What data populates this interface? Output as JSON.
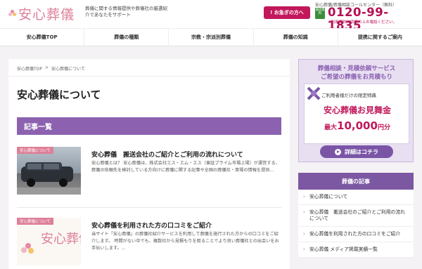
{
  "header": {
    "logo_text": "安心葬儀",
    "tagline": "葬儀に関する情報提供や葬儀社の厳選紹介であなたをサポート",
    "urgent_button": "! お急ぎの方へ",
    "call_center": "安心葬儀/葬儀相談コールセンター（無料）",
    "free_badge": "通話無料",
    "phone": "0120-99-1835",
    "call_note": "※利用規約に同意の上お電話ください。"
  },
  "nav": {
    "items": [
      "安心葬儀TOP",
      "葬儀の種類",
      "宗教・宗派別葬儀",
      "葬儀の知識",
      "提携に関するご案内"
    ]
  },
  "breadcrumb": {
    "home": "安心葬儀TOP",
    "separator": ">",
    "current": "安心葬儀について"
  },
  "page_title": "安心葬儀について",
  "section_title": "記事一覧",
  "articles": [
    {
      "tag": "安心葬儀について",
      "title": "安心葬儀　搬送会社のご紹介とご利用の流れについて",
      "excerpt": "安心葬儀とは？ 安心葬儀は、株式会社エス・エム・エス（東証プライム市場上場）が運営する、葬儀の依頼先を検討している方向けに葬儀に関する記事や全国の葬儀社・斎場の情報を提供..."
    },
    {
      "tag": "安心葬儀について",
      "title": "安心葬儀を利用された方の口コミをご紹介",
      "excerpt": "当サイト「安心葬儀」の葬儀社紹介サービスを利用して葬儀を施行された方からの口コミをご紹介します。 時間がない中でも、複数社から見積もりを取ることでより良い葬儀社との出会いをお手伝いします。..."
    }
  ],
  "sidebar": {
    "banner": {
      "line1": "葬儀相談・見積依頼サービス",
      "line2": "ご希望の葬儀をお見積もり",
      "sub": "ご利用者様だけの限定特典",
      "big": "安心葬儀お見舞金",
      "amount_prefix": "最大",
      "amount": "10,000",
      "amount_suffix": "円分",
      "button": "詳細はコチラ"
    },
    "section_title": "葬儀の記事",
    "items": [
      "安心葬儀について",
      "安心葬儀　搬送会社のご紹介とご利用の流れについて",
      "安心葬儀を利用された方の口コミをご紹介",
      "安心葬儀 メディア掲載実績一覧"
    ]
  },
  "colors": {
    "brand_pink": "#dd7f98",
    "accent_magenta": "#c2185b",
    "purple": "#8c62b0"
  }
}
